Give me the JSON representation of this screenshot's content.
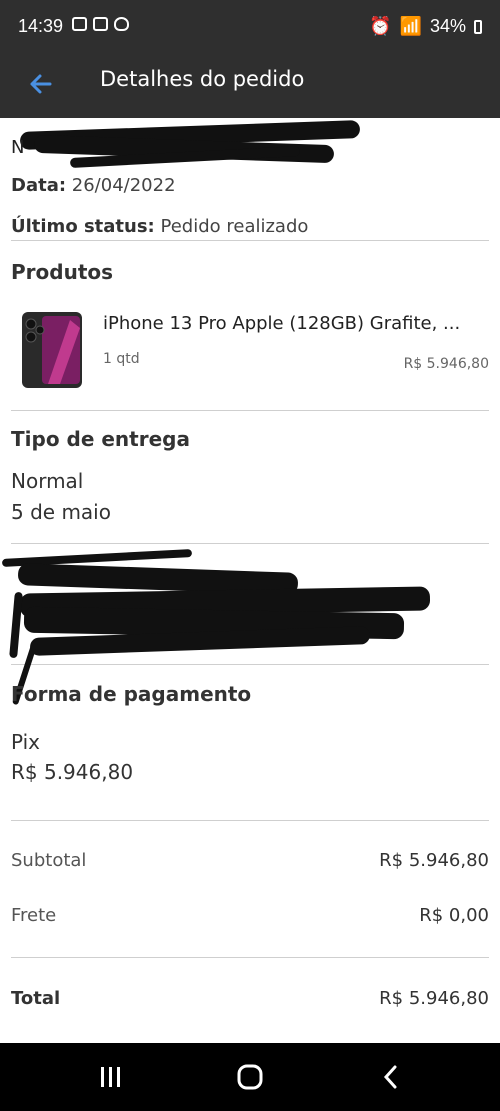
{
  "status_bar": {
    "time": "14:39",
    "battery": "34%"
  },
  "header": {
    "title": "Detalhes do pedido"
  },
  "order": {
    "date_label": "Data:",
    "date_value": "26/04/2022",
    "status_label": "Último status:",
    "status_value": "Pedido realizado"
  },
  "products": {
    "title": "Produtos",
    "item": {
      "name": "iPhone 13 Pro Apple (128GB) Grafite, ...",
      "qty": "1 qtd",
      "price": "R$ 5.946,80"
    }
  },
  "delivery": {
    "title": "Tipo de entrega",
    "type": "Normal",
    "date": "5 de maio"
  },
  "payment": {
    "title": "Forma de pagamento",
    "method": "Pix",
    "amount": "R$ 5.946,80"
  },
  "summary": {
    "subtotal_label": "Subtotal",
    "subtotal_value": "R$ 5.946,80",
    "shipping_label": "Frete",
    "shipping_value": "R$ 0,00",
    "total_label": "Total",
    "total_value": "R$ 5.946,80"
  },
  "colors": {
    "bar_bg": "#2f2f2f",
    "back_arrow": "#4a90e2",
    "divider": "#cfcfcf"
  }
}
